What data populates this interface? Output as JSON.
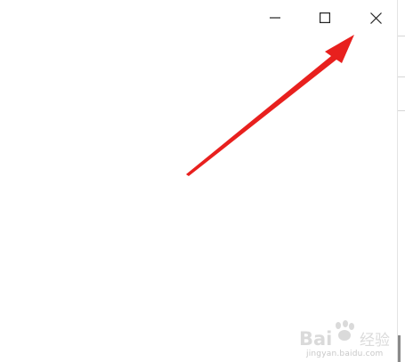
{
  "window": {
    "controls": {
      "minimize_icon": "minimize-icon",
      "maximize_icon": "maximize-icon",
      "close_icon": "close-icon"
    }
  },
  "annotation": {
    "color": "#e8201e",
    "target": "close-button"
  },
  "watermark": {
    "brand": "Bai 经验",
    "url": "jingyan.baidu.com"
  }
}
